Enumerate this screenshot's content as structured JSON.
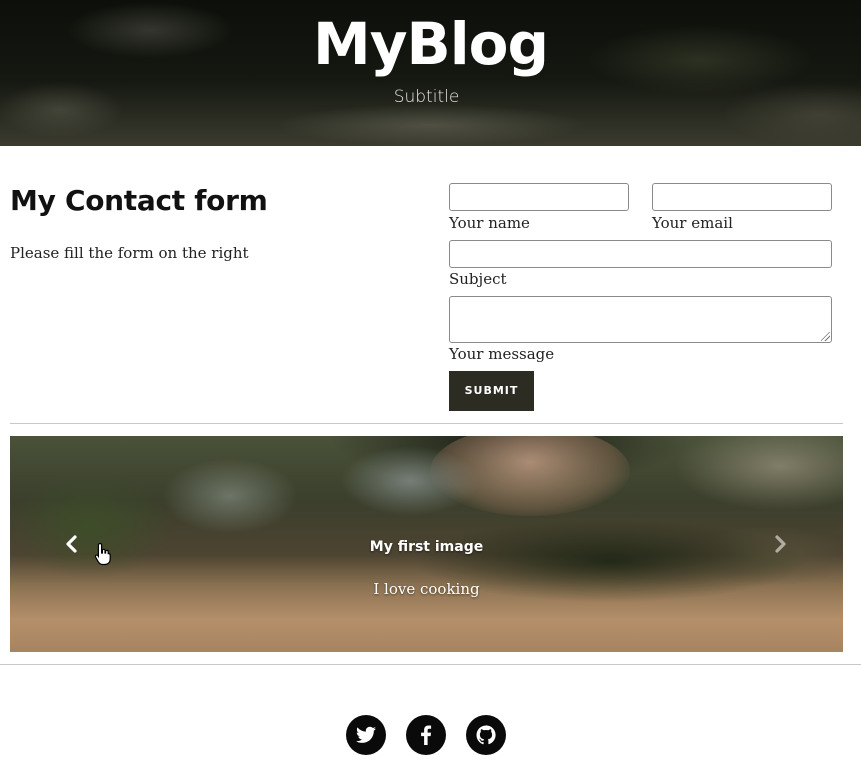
{
  "header": {
    "title": "MyBlog",
    "subtitle": "Subtitle"
  },
  "contact": {
    "title": "My Contact form",
    "description": "Please fill the form on the right",
    "fields": {
      "name": {
        "label": "Your name",
        "value": ""
      },
      "email": {
        "label": "Your email",
        "value": ""
      },
      "subject": {
        "label": "Subject",
        "value": ""
      },
      "message": {
        "label": "Your message",
        "value": ""
      }
    },
    "submit_label": "SUBMIT",
    "submit_color": "#2c2c22"
  },
  "carousel": {
    "slide_title": "My first image",
    "slide_text": "I love cooking",
    "prev_icon": "chevron-left-icon",
    "next_icon": "chevron-right-icon"
  },
  "social": [
    {
      "name": "twitter",
      "icon": "twitter-icon"
    },
    {
      "name": "facebook",
      "icon": "facebook-icon"
    },
    {
      "name": "github",
      "icon": "github-icon"
    }
  ]
}
